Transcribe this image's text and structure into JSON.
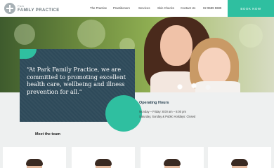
{
  "header": {
    "logo_small": "Park",
    "logo_big": "FAMILY PRACTICE",
    "nav": [
      "The Practice",
      "Practitioners",
      "Services",
      "Skin Checks",
      "Contact Us",
      "02 9589 5989"
    ],
    "book_button": "BOOK NOW"
  },
  "hero": {
    "quote": "“At Park Family Practice, we are committed to promoting excellent health care, wellbeing and illness prevention for all.”"
  },
  "hours": {
    "title": "Operating Hours",
    "lines": [
      "Monday – Friday: 8:00 am – 6:00 pm",
      "Saturday, Sunday & Public Holidays: Closed"
    ]
  },
  "team": {
    "title": "Meet the team"
  },
  "colors": {
    "accent": "#2fbfa0",
    "card": "#2e4a5a"
  }
}
